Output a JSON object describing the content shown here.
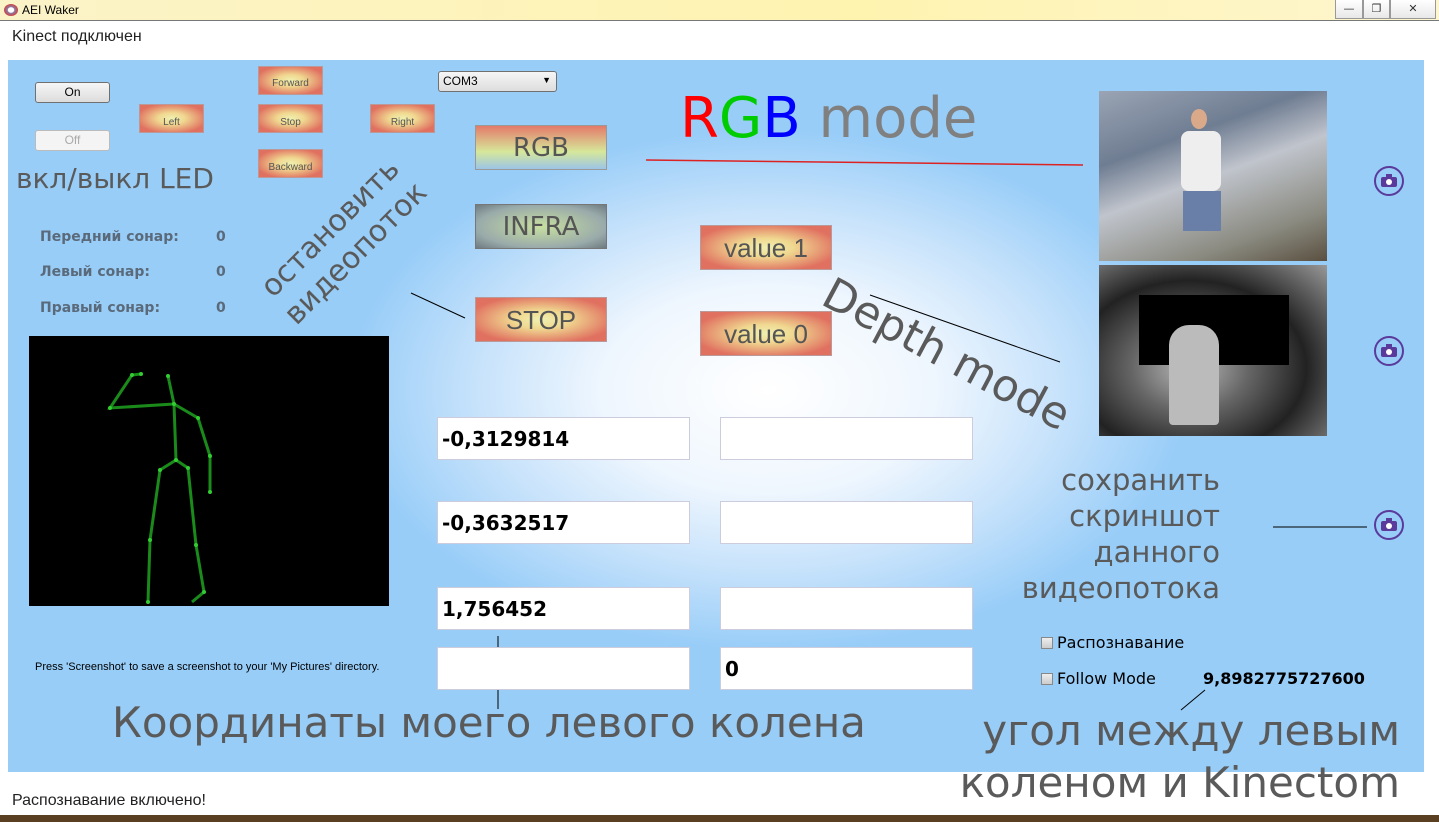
{
  "window": {
    "title": "AEI Waker",
    "controls": [
      "minimize",
      "maximize",
      "close"
    ]
  },
  "status_top": "Kinect подключен",
  "status_bottom": "Распознавание включено!",
  "led": {
    "on_label": "On",
    "off_label": "Off",
    "annotation": "вкл/выкл LED"
  },
  "drive": {
    "forward": "Forward",
    "left": "Left",
    "stop": "Stop",
    "right": "Right",
    "backward": "Backward"
  },
  "port_select": {
    "value": "COM3"
  },
  "stream_buttons": {
    "rgb": "RGB",
    "infra": "INFRA",
    "stop": "STOP",
    "value1": "value 1",
    "value0": "value 0"
  },
  "annotations": {
    "stop_stream_1": "остановить",
    "stop_stream_2": "видеопоток",
    "rgb_mode_r": "R",
    "rgb_mode_g": "G",
    "rgb_mode_b": "B",
    "rgb_mode_rest": " mode",
    "depth_mode": "Depth mode",
    "save_screenshot": [
      "сохранить",
      "скриншот",
      "данного",
      "видеопотока"
    ],
    "knee_coords": "Координаты моего левого колена",
    "angle_1": "угол между левым",
    "angle_2": "коленом и Kinectom"
  },
  "colors": {
    "R": "#ff0000",
    "G": "#00cc00",
    "B": "#0000ff",
    "accent": "#5a3a9a"
  },
  "sonars": [
    {
      "label": "Передний сонар:",
      "value": "0"
    },
    {
      "label": "Левый сонар:",
      "value": "0"
    },
    {
      "label": "Правый сонар:",
      "value": "0"
    }
  ],
  "hint": "Press 'Screenshot' to save a screenshot to your 'My Pictures' directory.",
  "fields_left": [
    "-0,3129814",
    "-0,3632517",
    "1,756452",
    ""
  ],
  "fields_right": [
    "",
    "",
    "",
    "0"
  ],
  "checkboxes": [
    {
      "label": "Распознавание",
      "checked": false
    },
    {
      "label": "Follow Mode",
      "checked": false
    }
  ],
  "angle_value": "9,8982775727600",
  "icons": {
    "camera": "camera-icon"
  }
}
